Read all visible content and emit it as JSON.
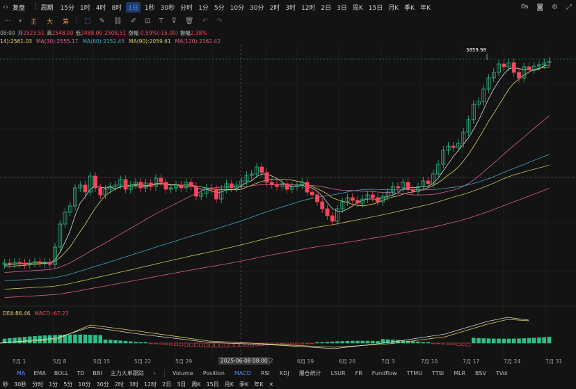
{
  "topbar": {
    "replay_label": "复盘",
    "period_label": "周期",
    "timeframes": [
      "15分",
      "1时",
      "4时",
      "8时",
      "1日",
      "1秒",
      "30秒",
      "分时",
      "1分",
      "5分",
      "10分",
      "30分",
      "2时",
      "3时",
      "12时",
      "2日",
      "3日",
      "周K",
      "15日",
      "月K",
      "季K",
      "年K"
    ],
    "active_timeframe": "1日",
    "right_text": "0s"
  },
  "toolbar2": {
    "labels": [
      "主",
      "大",
      "筹"
    ]
  },
  "ohlc": {
    "time": "08:00",
    "open_label": "开",
    "open": "2523.51",
    "high_label": "高",
    "high": "2548.00",
    "low_label": "低",
    "low": "2488.00",
    "close_label": "收",
    "close": "2508.51",
    "change_label": "涨幅",
    "change": "-0.59%(-15.00)",
    "amp_label": "振幅",
    "amp": "2.38%"
  },
  "ma_line": {
    "ma_partial": "14):2561.03",
    "ma30": "MA(30):2555.17",
    "ma60": "MA(60):2152.45",
    "ma90": "MA(90):2059.61",
    "ma120": "MA(120):2162.42"
  },
  "peak_label": "3859.98",
  "macd_info": {
    "dea": "DEA:86.46",
    "macd": "MACD:-67.23"
  },
  "x_labels": [
    "5月 1",
    "5月 8",
    "5月 15",
    "5月 22",
    "5月 29",
    "12",
    "6月 19",
    "6月 26",
    "7月 3",
    "7月 10",
    "7月 17",
    "7月 24",
    "7月 31"
  ],
  "crosshair_date": "2025-06-08 08:00",
  "indicator_tabs": {
    "left": [
      "MA",
      "EMA",
      "BOLL",
      "TD",
      "BBI",
      "主力大单跟踪"
    ],
    "arrow": "›",
    "right": [
      "Volume",
      "Position",
      "MACD",
      "RSI",
      "KDJ",
      "爆仓统计",
      "LSUR",
      "FR",
      "Fundflow",
      "TTMU",
      "TTSI",
      "MLR",
      "BSV",
      "TVol"
    ],
    "active_left": "MA",
    "active_right": "MACD"
  },
  "bottombar": {
    "items": [
      "秒",
      "30秒",
      "分时",
      "1分",
      "5分",
      "10分",
      "30分",
      "2时",
      "3时",
      "12时",
      "2日",
      "3日",
      "周K",
      "15日",
      "月K",
      "季K",
      "年K"
    ],
    "close": "✕"
  },
  "colors": {
    "up": "#2ebd85",
    "down": "#f6465d",
    "accent": "#4d8bff",
    "ma_yellow": "#e8d35a",
    "ma_pink": "#e05fa0",
    "ma_blue": "#3fa7c7",
    "ma_olive": "#c8c060",
    "ma_red": "#d8607a"
  }
}
